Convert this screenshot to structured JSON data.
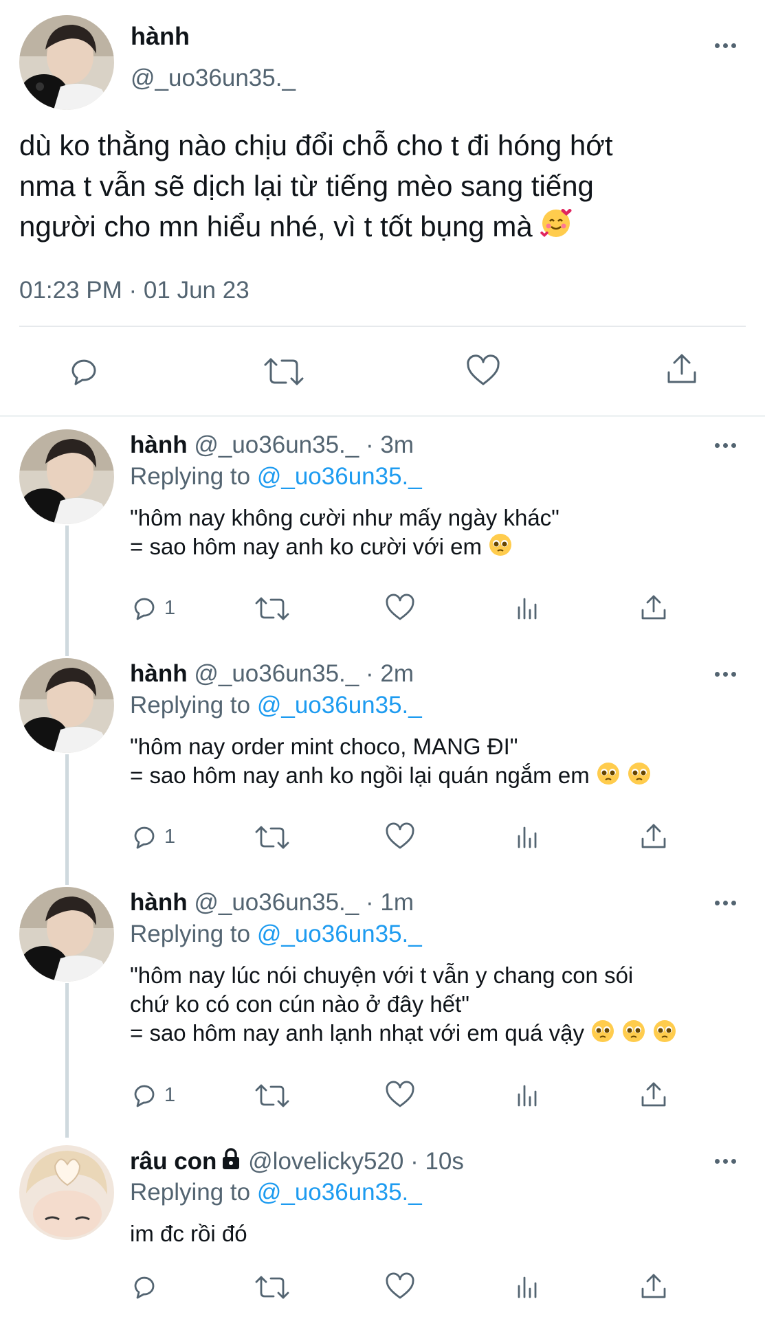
{
  "main_tweet": {
    "name": "hành",
    "handle": "@_uo36un35._",
    "lines": [
      "dù ko thằng nào chịu đổi chỗ cho t đi hóng hớt",
      "nma t vẫn sẽ dịch lại từ tiếng mèo sang tiếng",
      "người cho mn hiểu nhé, vì t tốt bụng mà"
    ],
    "timestamp": "01:23 PM · 01 Jun 23"
  },
  "replies": [
    {
      "name": "hành",
      "handle": "@_uo36un35._",
      "time": "· 3m",
      "replying_label": "Replying to",
      "replying_to": "@_uo36un35._",
      "lines": [
        "\"hôm nay không cười như mấy ngày khác\"",
        "= sao hôm nay anh ko cười với em"
      ],
      "reply_count": "1"
    },
    {
      "name": "hành",
      "handle": "@_uo36un35._",
      "time": "· 2m",
      "replying_label": "Replying to",
      "replying_to": "@_uo36un35._",
      "lines": [
        "\"hôm nay order mint choco, MANG ĐI\"",
        "= sao hôm nay anh ko ngồi lại quán ngắm em"
      ],
      "reply_count": "1"
    },
    {
      "name": "hành",
      "handle": "@_uo36un35._",
      "time": "· 1m",
      "replying_label": "Replying to",
      "replying_to": "@_uo36un35._",
      "lines": [
        "\"hôm nay lúc nói chuyện với t vẫn y chang con sói",
        "chứ ko có con cún nào ở đây hết\"",
        "= sao hôm nay anh lạnh nhạt với em quá vậy"
      ],
      "reply_count": "1"
    },
    {
      "name": "râu con",
      "handle": "@lovelicky520",
      "time": "· 10s",
      "replying_label": "Replying to",
      "replying_to": "@_uo36un35._",
      "lines": [
        "im đc rồi đó"
      ],
      "reply_count": ""
    }
  ],
  "icons": {
    "reply": "reply-icon",
    "retweet": "retweet-icon",
    "like": "heart-icon",
    "views": "views-icon",
    "share": "share-icon",
    "more": "more-icon",
    "lock": "lock-icon",
    "emoji_smiling_hearts": "smiling-face-with-hearts-emoji",
    "emoji_pleading": "pleading-face-emoji"
  },
  "colors": {
    "link": "#1d9bf0",
    "secondary_text": "#536471",
    "thread_line": "#cfd9de"
  }
}
